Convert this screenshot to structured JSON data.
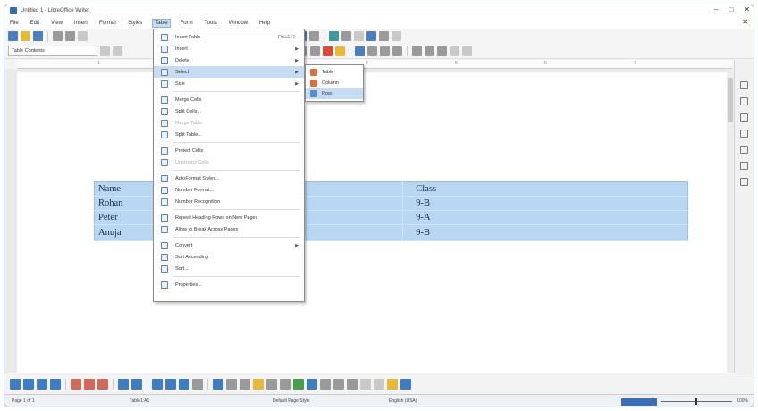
{
  "window": {
    "title": "Untitled 1 - LibreOffice Writer"
  },
  "menu": [
    "File",
    "Edit",
    "View",
    "Insert",
    "Format",
    "Styles",
    "Table",
    "Form",
    "Tools",
    "Window",
    "Help"
  ],
  "active_menu": "Table",
  "style_box": "Table Contents",
  "ruler_numbers": [
    "1",
    "2",
    "3",
    "4",
    "5",
    "6",
    "7"
  ],
  "table_menu": [
    {
      "label": "Insert Table...",
      "shortcut": "Ctrl+F12",
      "arrow": false,
      "disabled": false,
      "sep_after": false
    },
    {
      "label": "Insert",
      "arrow": true,
      "disabled": false
    },
    {
      "label": "Delete",
      "arrow": true,
      "disabled": false
    },
    {
      "label": "Select",
      "arrow": true,
      "disabled": false,
      "highlight": true
    },
    {
      "label": "Size",
      "arrow": true,
      "disabled": false,
      "sep_after": true
    },
    {
      "label": "Merge Cells",
      "arrow": false,
      "disabled": false
    },
    {
      "label": "Split Cells...",
      "arrow": false,
      "disabled": false
    },
    {
      "label": "Merge Table",
      "arrow": false,
      "disabled": true
    },
    {
      "label": "Split Table...",
      "arrow": false,
      "disabled": false,
      "sep_after": true
    },
    {
      "label": "Protect Cells",
      "arrow": false,
      "disabled": false
    },
    {
      "label": "Unprotect Cells",
      "arrow": false,
      "disabled": true,
      "sep_after": true
    },
    {
      "label": "AutoFormat Styles...",
      "arrow": false,
      "disabled": false
    },
    {
      "label": "Number Format...",
      "arrow": false,
      "disabled": false
    },
    {
      "label": "Number Recognition",
      "arrow": false,
      "disabled": false,
      "sep_after": true
    },
    {
      "label": "Repeat Heading Rows on New Pages",
      "arrow": false,
      "disabled": false
    },
    {
      "label": "Allow to Break Across Pages",
      "arrow": false,
      "disabled": false,
      "sep_after": true
    },
    {
      "label": "Convert",
      "arrow": true,
      "disabled": false
    },
    {
      "label": "Sort Ascending",
      "arrow": false,
      "disabled": false
    },
    {
      "label": "Sort...",
      "arrow": false,
      "disabled": false,
      "sep_after": true
    },
    {
      "label": "Properties...",
      "arrow": false,
      "disabled": false
    }
  ],
  "select_submenu": [
    "Table",
    "Column",
    "Row"
  ],
  "table": {
    "rows": [
      [
        "Name",
        "",
        "Class"
      ],
      [
        "Rohan",
        "",
        "9-B"
      ],
      [
        "Peter",
        "",
        "9-A"
      ],
      [
        "Anuja",
        "",
        "9-B"
      ]
    ]
  },
  "status": {
    "page": "Page 1 of 1",
    "words": "Table1:A1",
    "page_style": "Default Page Style",
    "language": "English (USA)",
    "zoom": "100%"
  },
  "colors": {
    "table_fill": "#b9d7f2",
    "highlight": "#c6dcf2",
    "accent": "#2f6fb8"
  }
}
